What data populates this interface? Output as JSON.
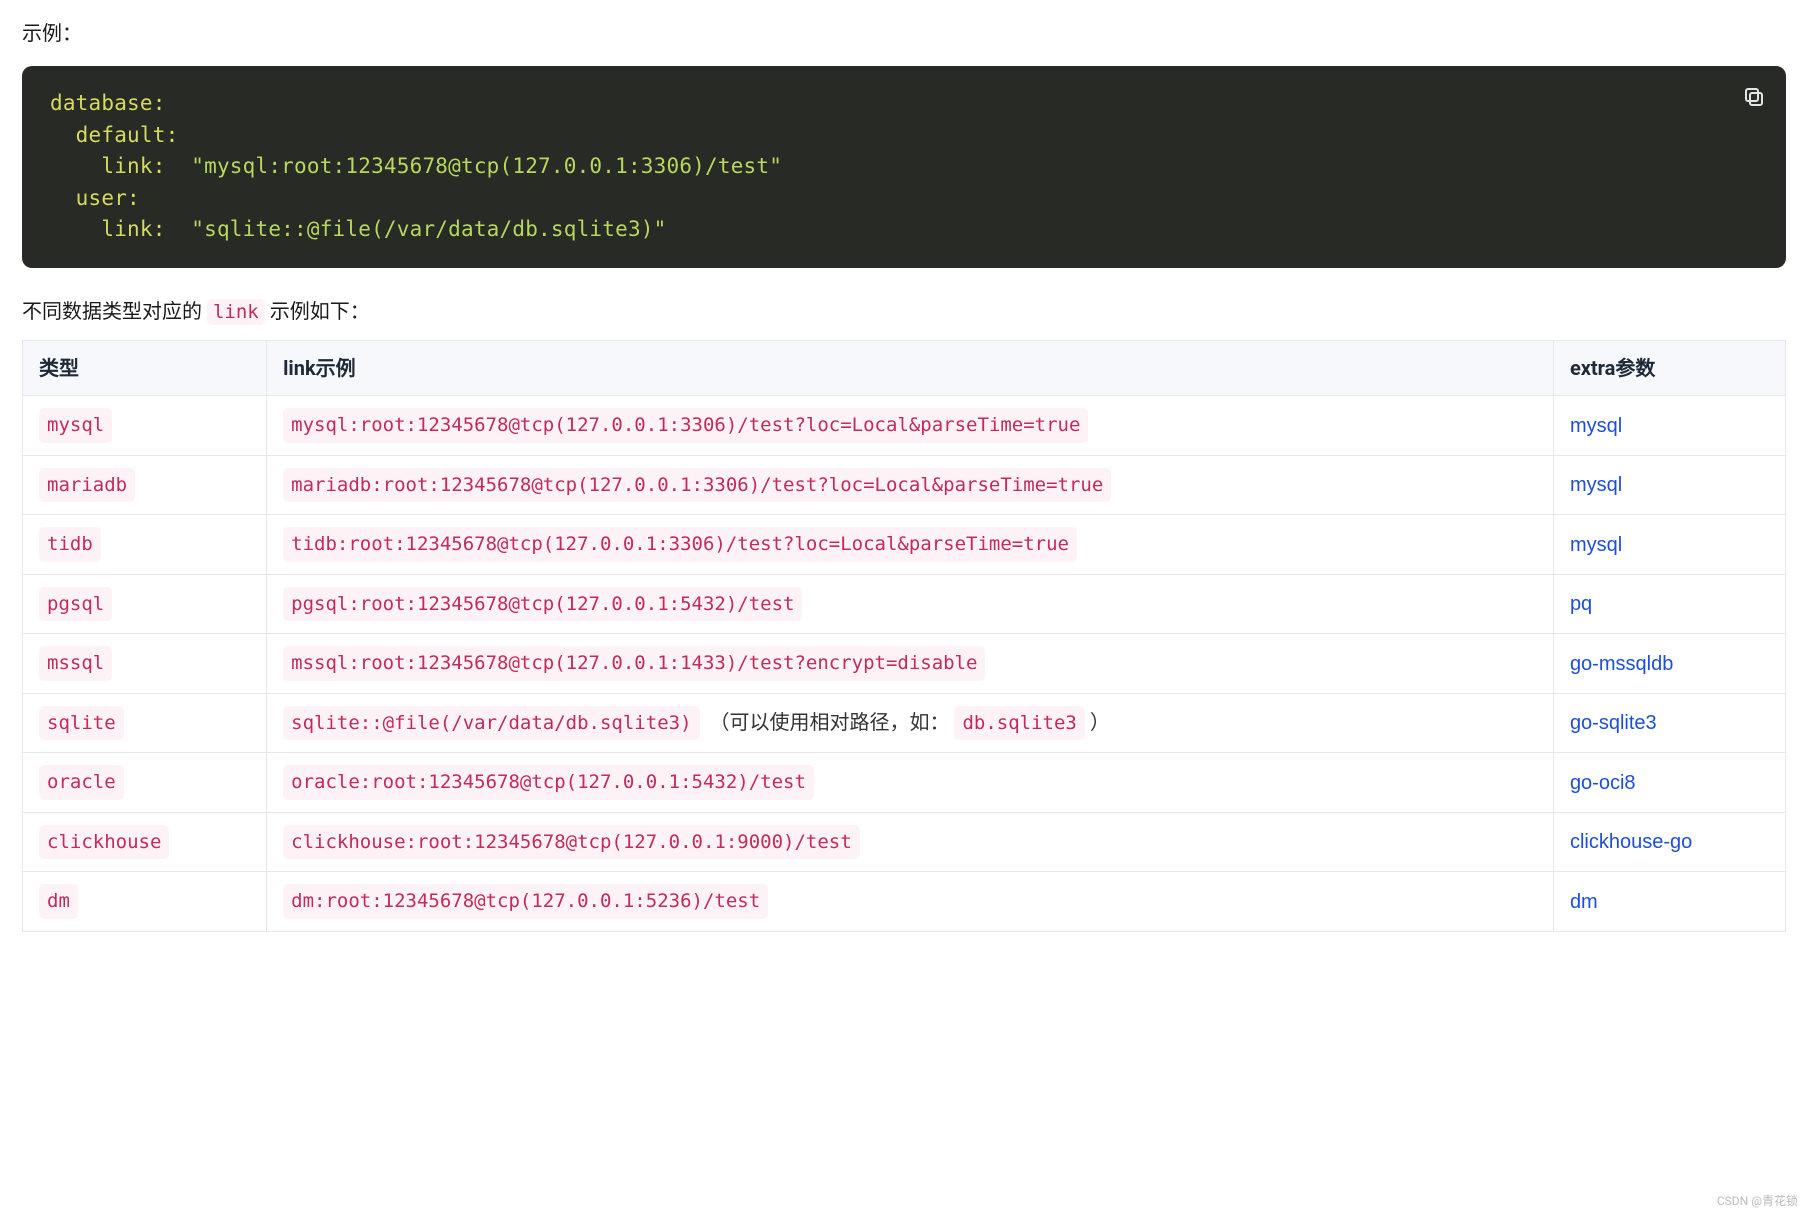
{
  "intro": "示例：",
  "code_block": {
    "copy_label": "Copy",
    "lines": [
      {
        "parts": [
          {
            "cls": "kw",
            "text": "database:"
          }
        ]
      },
      {
        "parts": [
          {
            "cls": "kw",
            "text": "  default:"
          }
        ]
      },
      {
        "parts": [
          {
            "cls": "kw",
            "text": "    link:  "
          },
          {
            "cls": "str",
            "text": "\"mysql:root:12345678@tcp(127.0.0.1:3306)/test\""
          }
        ]
      },
      {
        "parts": [
          {
            "cls": "kw",
            "text": "  user:"
          }
        ]
      },
      {
        "parts": [
          {
            "cls": "kw",
            "text": "    link:  "
          },
          {
            "cls": "str",
            "text": "\"sqlite::@file(/var/data/db.sqlite3)\""
          }
        ]
      }
    ]
  },
  "para": {
    "prefix": "不同数据类型对应的 ",
    "code": "link",
    "suffix": " 示例如下：",
    "full": "不同数据类型对应的 link 示例如下："
  },
  "table": {
    "headers": {
      "type": "类型",
      "example": "link示例",
      "extra": "extra参数"
    },
    "rows": [
      {
        "type": "mysql",
        "example": "mysql:root:12345678@tcp(127.0.0.1:3306)/test?loc=Local&parseTime=true",
        "note": "",
        "extra": "mysql"
      },
      {
        "type": "mariadb",
        "example": "mariadb:root:12345678@tcp(127.0.0.1:3306)/test?loc=Local&parseTime=true",
        "note": "",
        "extra": "mysql"
      },
      {
        "type": "tidb",
        "example": "tidb:root:12345678@tcp(127.0.0.1:3306)/test?loc=Local&parseTime=true",
        "note": "",
        "extra": "mysql"
      },
      {
        "type": "pgsql",
        "example": "pgsql:root:12345678@tcp(127.0.0.1:5432)/test",
        "note": "",
        "extra": "pq"
      },
      {
        "type": "mssql",
        "example": "mssql:root:12345678@tcp(127.0.0.1:1433)/test?encrypt=disable",
        "note": "",
        "extra": "go-mssqldb"
      },
      {
        "type": "sqlite",
        "example": "sqlite::@file(/var/data/db.sqlite3)",
        "note_prefix": "（可以使用相对路径，如：",
        "note_code": "db.sqlite3",
        "note_suffix": "）",
        "extra": "go-sqlite3"
      },
      {
        "type": "oracle",
        "example": "oracle:root:12345678@tcp(127.0.0.1:5432)/test",
        "note": "",
        "extra": "go-oci8"
      },
      {
        "type": "clickhouse",
        "example": "clickhouse:root:12345678@tcp(127.0.0.1:9000)/test",
        "note": "",
        "extra": "clickhouse-go"
      },
      {
        "type": "dm",
        "example": "dm:root:12345678@tcp(127.0.0.1:5236)/test",
        "note": "",
        "extra": "dm"
      }
    ]
  },
  "watermark": "CSDN @青花锁"
}
